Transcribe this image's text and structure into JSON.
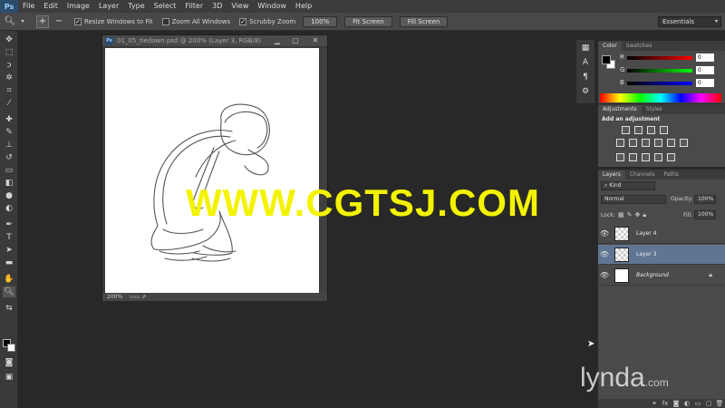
{
  "app": {
    "logo": "Ps"
  },
  "menu": [
    "File",
    "Edit",
    "Image",
    "Layer",
    "Type",
    "Select",
    "Filter",
    "3D",
    "View",
    "Window",
    "Help"
  ],
  "options": {
    "resize_windows": "Resize Windows to Fit",
    "zoom_all": "Zoom All Windows",
    "scrubby_zoom": "Scrubby Zoom",
    "btn_100": "100%",
    "btn_fit": "Fit Screen",
    "btn_fill": "Fill Screen",
    "workspace": "Essentials"
  },
  "document": {
    "title": "01_05_tiedown.psd @ 200% (Layer 3, RGB/8)",
    "zoom": "200%"
  },
  "color_panel": {
    "tabs": [
      "Color",
      "Swatches"
    ],
    "r_label": "R",
    "g_label": "G",
    "b_label": "B",
    "r_val": "0",
    "g_val": "0",
    "b_val": "0",
    "colors": {
      "red": "#ff0000",
      "green": "#00ff00",
      "blue": "#0000ff"
    }
  },
  "adjustments_panel": {
    "tabs": [
      "Adjustments",
      "Styles"
    ],
    "title": "Add an adjustment"
  },
  "layers_panel": {
    "tabs": [
      "Layers",
      "Channels",
      "Paths"
    ],
    "kind": "Kind",
    "blend_mode": "Normal",
    "opacity_label": "Opacity:",
    "opacity_value": "100%",
    "lock_label": "Lock:",
    "fill_label": "Fill:",
    "fill_value": "100%",
    "layers": [
      {
        "name": "Layer 4"
      },
      {
        "name": "Layer 3"
      },
      {
        "name": "Background"
      }
    ]
  },
  "watermark": "WWW.CGTSJ.COM",
  "branding": "lynda",
  "branding_suffix": ".com"
}
